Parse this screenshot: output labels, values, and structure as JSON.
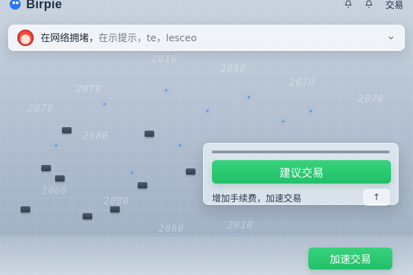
{
  "app": {
    "brand": "Birpie"
  },
  "top_actions": {
    "trade_label": "交易"
  },
  "banner": {
    "main_text": "在网络拥堵，",
    "muted_text": "在示提示，te，lesceo"
  },
  "card": {
    "primary_label": "建议交易",
    "hint_text": "增加手续费，加速交易",
    "up_label": "↑"
  },
  "footer": {
    "accelerate_label": "加速交易"
  },
  "icons": {
    "bell": "bell-icon",
    "chevron": "chevron-down-icon",
    "avatar": "avatar",
    "logo": "logo-icon"
  },
  "colors": {
    "accent_blue": "#2a77f2",
    "success_green": "#22c06a"
  }
}
